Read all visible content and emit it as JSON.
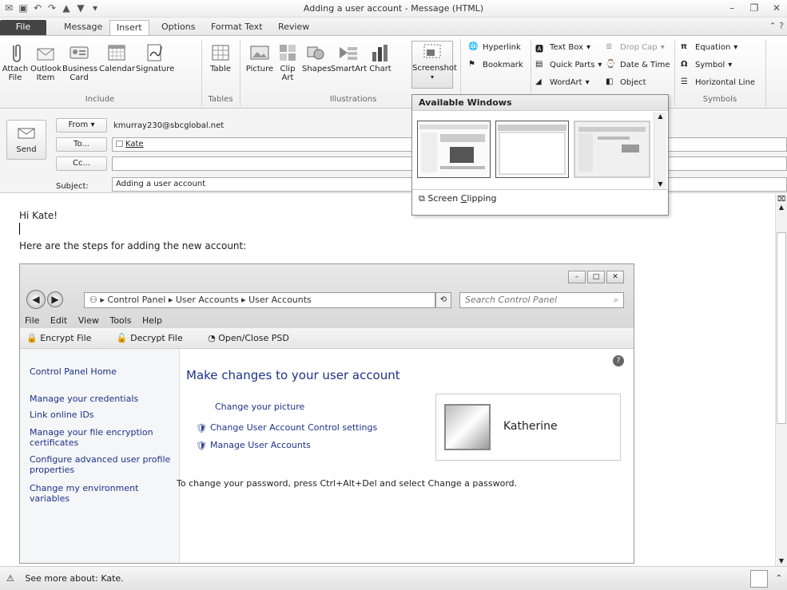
{
  "window": {
    "title": "Adding a user account - Message (HTML)"
  },
  "tabs": [
    "File",
    "Message",
    "Insert",
    "Options",
    "Format Text",
    "Review"
  ],
  "active_tab": "Insert",
  "ribbon": {
    "include": {
      "label": "Include",
      "attach_file": "Attach File",
      "outlook_item": "Outlook Item",
      "business_card": "Business Card",
      "calendar": "Calendar",
      "signature": "Signature"
    },
    "tables": {
      "label": "Tables",
      "table": "Table"
    },
    "illustrations": {
      "label": "Illustrations",
      "picture": "Picture",
      "clip_art": "Clip Art",
      "shapes": "Shapes",
      "smartart": "SmartArt",
      "chart": "Chart",
      "screenshot": "Screenshot"
    },
    "links": {
      "hyperlink": "Hyperlink",
      "bookmark": "Bookmark"
    },
    "text": {
      "text_box": "Text Box",
      "quick_parts": "Quick Parts",
      "wordart": "WordArt",
      "drop_cap": "Drop Cap",
      "date_time": "Date & Time",
      "object": "Object"
    },
    "symbols": {
      "label": "Symbols",
      "equation": "Equation",
      "symbol": "Symbol",
      "horizontal_line": "Horizontal Line"
    }
  },
  "compose": {
    "send": "Send",
    "from_button": "From",
    "from_value": "kmurray230@sbcglobal.net",
    "to_button": "To...",
    "to_value": "Kate",
    "cc_button": "Cc...",
    "subject_label": "Subject:",
    "subject_value": "Adding a user account"
  },
  "screenshot_dropdown": {
    "header": "Available Windows",
    "footer_pre": "Screen ",
    "footer_ul": "C",
    "footer_post": "lipping"
  },
  "body": {
    "greeting": "Hi Kate!",
    "steps": "Here are the steps for adding the new account:"
  },
  "control_panel": {
    "address_segments": [
      "Control Panel",
      "User Accounts",
      "User Accounts"
    ],
    "search_placeholder": "Search Control Panel",
    "menu": [
      "File",
      "Edit",
      "View",
      "Tools",
      "Help"
    ],
    "toolbar": [
      "Encrypt File",
      "Decrypt File",
      "Open/Close PSD"
    ],
    "left_links": [
      "Control Panel Home",
      "Manage your credentials",
      "Link online IDs",
      "Manage your file encryption certificates",
      "Configure advanced user profile properties",
      "Change my environment variables"
    ],
    "title": "Make changes to your user account",
    "actions": [
      "Change your picture",
      "Change User Account Control settings",
      "Manage User Accounts"
    ],
    "username": "Katherine",
    "password_note": "To change your password, press Ctrl+Alt+Del and select Change a password."
  },
  "status": {
    "text": "See more about: Kate."
  }
}
